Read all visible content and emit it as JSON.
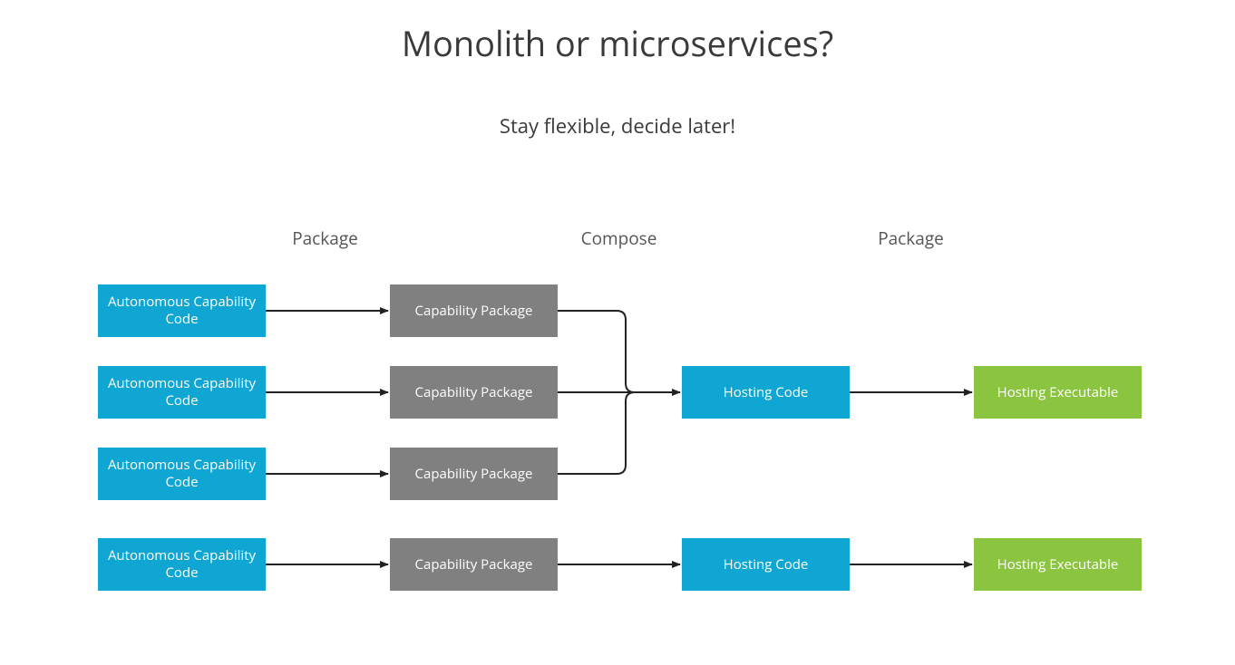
{
  "title": "Monolith or microservices?",
  "subtitle": "Stay flexible, decide later!",
  "columns": {
    "package1": "Package",
    "compose": "Compose",
    "package2": "Package"
  },
  "boxes": {
    "ac1": "Autonomous Capability Code",
    "ac2": "Autonomous Capability Code",
    "ac3": "Autonomous Capability Code",
    "ac4": "Autonomous Capability Code",
    "cp1": "Capability Package",
    "cp2": "Capability Package",
    "cp3": "Capability Package",
    "cp4": "Capability Package",
    "hc1": "Hosting Code",
    "hc2": "Hosting Code",
    "he1": "Hosting Executable",
    "he2": "Hosting Executable"
  },
  "colors": {
    "blue": "#0fa6d4",
    "gray": "#808080",
    "green": "#8bc540"
  }
}
